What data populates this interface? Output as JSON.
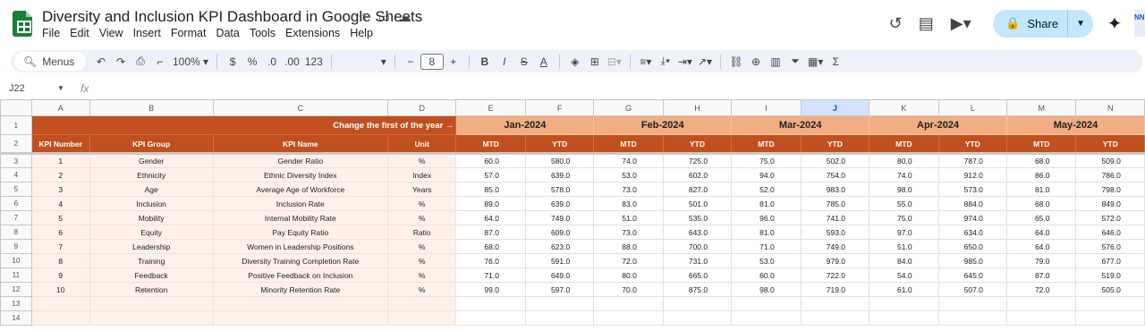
{
  "app": {
    "doc_title": "Diversity and Inclusion KPI Dashboard in Google Sheets",
    "title_icons": [
      "star-icon",
      "move-folder-icon",
      "cloud-status-icon"
    ],
    "menu": [
      "File",
      "Edit",
      "View",
      "Insert",
      "Format",
      "Data",
      "Tools",
      "Extensions",
      "Help"
    ],
    "share_label": "Share",
    "avatar_text": "NN"
  },
  "toolbar": {
    "search_label": "Menus",
    "zoom": "100%",
    "currency": "$",
    "percent": "%",
    "dec_decrease": ".0",
    "dec_increase": ".00",
    "number_format": "123",
    "font_size": "8",
    "bold": "B",
    "italic": "I",
    "text_color": "A"
  },
  "formula_bar": {
    "name_box": "J22",
    "fx": "fx"
  },
  "sheet": {
    "columns": [
      "A",
      "B",
      "C",
      "D",
      "E",
      "F",
      "G",
      "H",
      "I",
      "J",
      "K",
      "L",
      "M",
      "N"
    ],
    "selected_column": "J",
    "banner": "Change the first of the year →",
    "months": [
      "Jan-2024",
      "Feb-2024",
      "Mar-2024",
      "Apr-2024",
      "May-2024"
    ],
    "headers": [
      "KPI Number",
      "KPI Group",
      "KPI Name",
      "Unit"
    ],
    "sub_headers": [
      "MTD",
      "YTD"
    ],
    "row_numbers": [
      "1",
      "2",
      "3",
      "4",
      "5",
      "6",
      "7",
      "8",
      "9",
      "10",
      "11",
      "12",
      "13",
      "14"
    ],
    "rows": [
      {
        "num": "1",
        "group": "Gender",
        "name": "Gender Ratio",
        "unit": "%",
        "values": [
          "60.0",
          "580.0",
          "74.0",
          "725.0",
          "75.0",
          "502.0",
          "80.0",
          "787.0",
          "68.0",
          "509.0"
        ]
      },
      {
        "num": "2",
        "group": "Ethnicity",
        "name": "Ethnic Diversity Index",
        "unit": "Index",
        "values": [
          "57.0",
          "639.0",
          "53.0",
          "602.0",
          "94.0",
          "754.0",
          "74.0",
          "912.0",
          "86.0",
          "786.0"
        ]
      },
      {
        "num": "3",
        "group": "Age",
        "name": "Average Age of Workforce",
        "unit": "Years",
        "values": [
          "85.0",
          "578.0",
          "73.0",
          "827.0",
          "52.0",
          "983.0",
          "98.0",
          "573.0",
          "81.0",
          "798.0"
        ]
      },
      {
        "num": "4",
        "group": "Inclusion",
        "name": "Inclusion Rate",
        "unit": "%",
        "values": [
          "89.0",
          "639.0",
          "83.0",
          "501.0",
          "81.0",
          "785.0",
          "55.0",
          "884.0",
          "68.0",
          "849.0"
        ]
      },
      {
        "num": "5",
        "group": "Mobility",
        "name": "Internal Mobility Rate",
        "unit": "%",
        "values": [
          "64.0",
          "749.0",
          "51.0",
          "535.0",
          "96.0",
          "741.0",
          "75.0",
          "974.0",
          "65.0",
          "572.0"
        ]
      },
      {
        "num": "6",
        "group": "Equity",
        "name": "Pay Equity Ratio",
        "unit": "Ratio",
        "values": [
          "87.0",
          "609.0",
          "73.0",
          "643.0",
          "81.0",
          "593.0",
          "97.0",
          "634.0",
          "64.0",
          "646.0"
        ]
      },
      {
        "num": "7",
        "group": "Leadership",
        "name": "Women in Leadership Positions",
        "unit": "%",
        "values": [
          "68.0",
          "623.0",
          "88.0",
          "700.0",
          "71.0",
          "749.0",
          "51.0",
          "650.0",
          "64.0",
          "576.0"
        ]
      },
      {
        "num": "8",
        "group": "Training",
        "name": "Diversity Training Completion Rate",
        "unit": "%",
        "values": [
          "76.0",
          "591.0",
          "72.0",
          "731.0",
          "53.0",
          "979.0",
          "84.0",
          "985.0",
          "79.0",
          "677.0"
        ]
      },
      {
        "num": "9",
        "group": "Feedback",
        "name": "Positive Feedback on Inclusion",
        "unit": "%",
        "values": [
          "71.0",
          "649.0",
          "80.0",
          "665.0",
          "60.0",
          "722.0",
          "54.0",
          "645.0",
          "87.0",
          "519.0"
        ]
      },
      {
        "num": "10",
        "group": "Retention",
        "name": "Minority Retention Rate",
        "unit": "%",
        "values": [
          "99.0",
          "597.0",
          "70.0",
          "875.0",
          "98.0",
          "719.0",
          "61.0",
          "507.0",
          "72.0",
          "505.0"
        ]
      }
    ]
  },
  "colors": {
    "header_dark": "#c0501f",
    "header_light": "#f3ad82",
    "kpi_fill": "#fdf1ea",
    "share_bg": "#c2e7ff"
  }
}
